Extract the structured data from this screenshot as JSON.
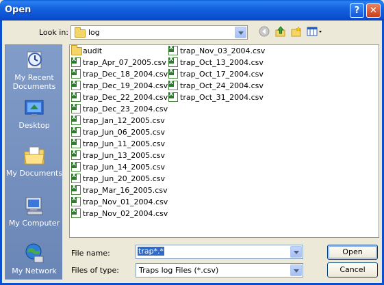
{
  "window": {
    "title": "Open"
  },
  "titlebar": {
    "help_label": "?",
    "close_label": "✕"
  },
  "lookin": {
    "label": "Look in:",
    "value": "log"
  },
  "toolbar": {
    "back_icon": "back-icon",
    "up_icon": "up-folder-icon",
    "newfolder_icon": "new-folder-icon",
    "views_icon": "views-menu-icon"
  },
  "places": [
    {
      "label": "My Recent Documents",
      "icon": "recent-documents-icon"
    },
    {
      "label": "Desktop",
      "icon": "desktop-icon"
    },
    {
      "label": "My Documents",
      "icon": "my-documents-icon"
    },
    {
      "label": "My Computer",
      "icon": "my-computer-icon"
    },
    {
      "label": "My Network",
      "icon": "my-network-icon"
    }
  ],
  "files": {
    "column1": [
      {
        "name": "audit",
        "type": "folder"
      },
      {
        "name": "trap_Apr_07_2005.csv",
        "type": "csv"
      },
      {
        "name": "trap_Dec_18_2004.csv",
        "type": "csv"
      },
      {
        "name": "trap_Dec_19_2004.csv",
        "type": "csv"
      },
      {
        "name": "trap_Dec_22_2004.csv",
        "type": "csv"
      },
      {
        "name": "trap_Dec_23_2004.csv",
        "type": "csv"
      },
      {
        "name": "trap_Jan_12_2005.csv",
        "type": "csv"
      },
      {
        "name": "trap_Jun_06_2005.csv",
        "type": "csv"
      },
      {
        "name": "trap_Jun_11_2005.csv",
        "type": "csv"
      },
      {
        "name": "trap_Jun_13_2005.csv",
        "type": "csv"
      },
      {
        "name": "trap_Jun_14_2005.csv",
        "type": "csv"
      },
      {
        "name": "trap_Jun_20_2005.csv",
        "type": "csv"
      },
      {
        "name": "trap_Mar_16_2005.csv",
        "type": "csv"
      },
      {
        "name": "trap_Nov_01_2004.csv",
        "type": "csv"
      },
      {
        "name": "trap_Nov_02_2004.csv",
        "type": "csv"
      }
    ],
    "column2": [
      {
        "name": "trap_Nov_03_2004.csv",
        "type": "csv"
      },
      {
        "name": "trap_Oct_13_2004.csv",
        "type": "csv"
      },
      {
        "name": "trap_Oct_17_2004.csv",
        "type": "csv"
      },
      {
        "name": "trap_Oct_24_2004.csv",
        "type": "csv"
      },
      {
        "name": "trap_Oct_31_2004.csv",
        "type": "csv"
      }
    ]
  },
  "filename": {
    "label": "File name:",
    "value": "trap*.*"
  },
  "filetype": {
    "label": "Files of type:",
    "value": "Traps log Files (*.csv)"
  },
  "buttons": {
    "open": "Open",
    "cancel": "Cancel"
  },
  "colors": {
    "titlebar": "#0a4fd0",
    "selection": "#316ac5",
    "window_bg": "#ece9d8"
  }
}
